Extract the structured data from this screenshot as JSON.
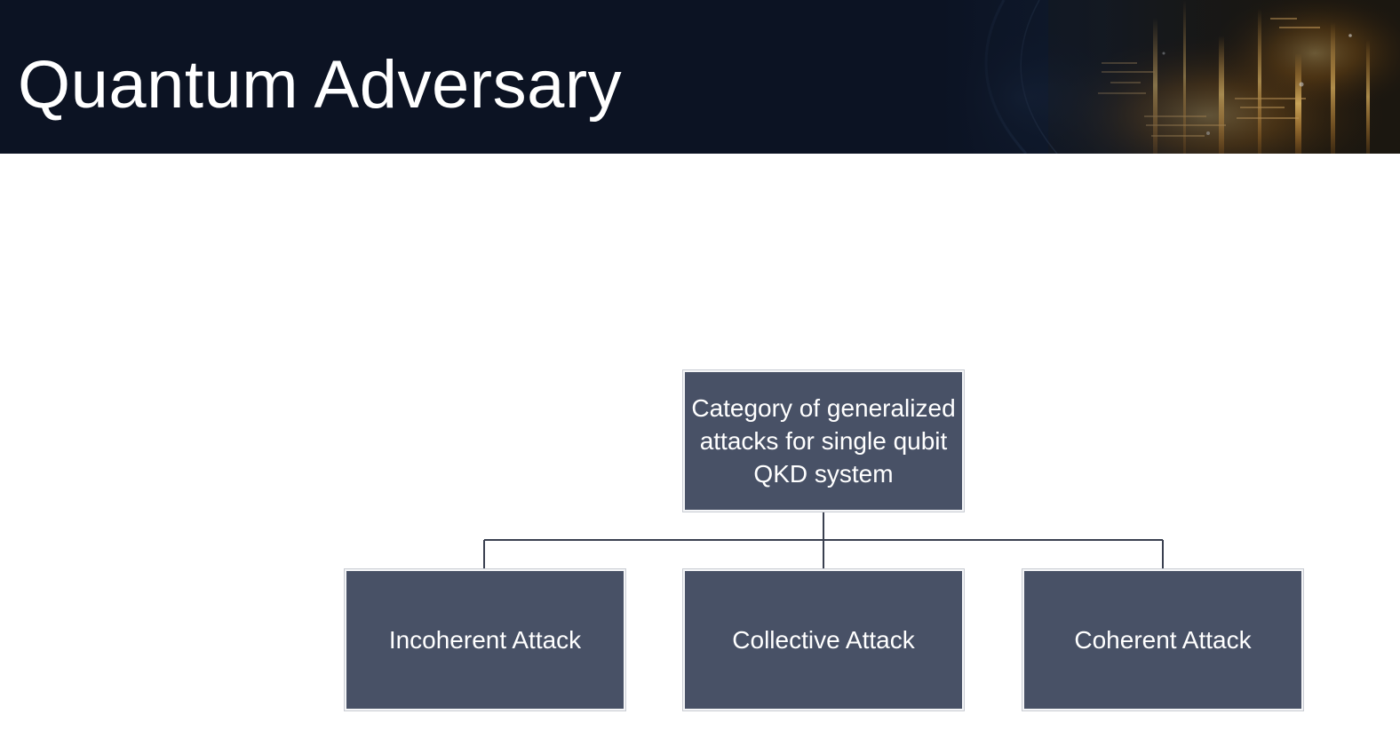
{
  "slide": {
    "title": "Quantum Adversary"
  },
  "diagram": {
    "root": {
      "label": "Category of generalized attacks for single qubit QKD system"
    },
    "children": [
      {
        "label": "Incoherent Attack"
      },
      {
        "label": "Collective Attack"
      },
      {
        "label": "Coherent Attack"
      }
    ]
  },
  "colors": {
    "header_background": "#0c1323",
    "node_fill": "#485166",
    "node_text": "#ffffff",
    "connector": "#3a4050",
    "accent_glow": "#f2a23a"
  },
  "icons": {
    "header_art": "digital-code-glow-image"
  }
}
